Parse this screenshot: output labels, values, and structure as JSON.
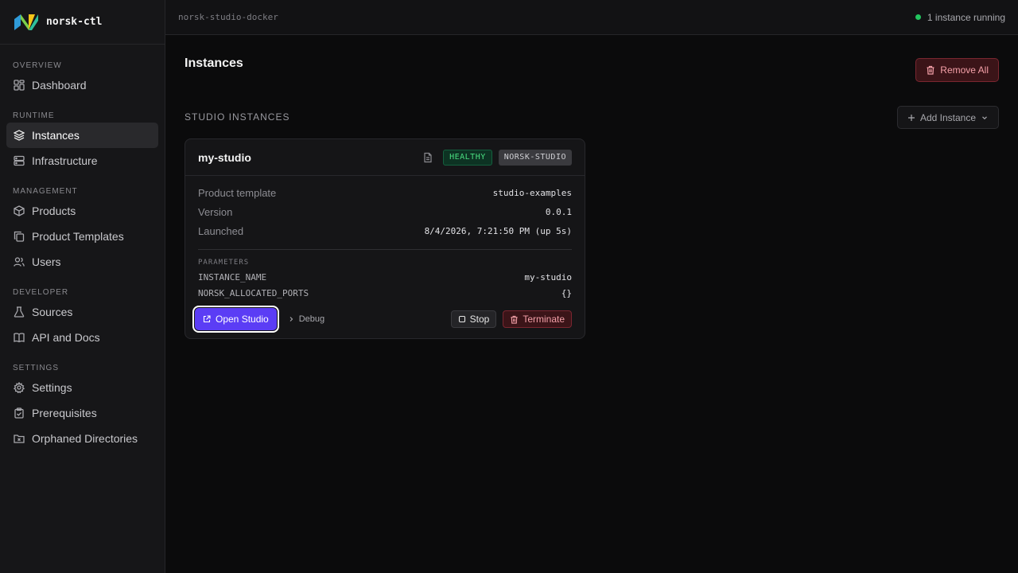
{
  "brand": {
    "name": "norsk-ctl",
    "logo_icon": "norsk-logo-icon"
  },
  "sidebar": {
    "sections": [
      {
        "label": "OVERVIEW",
        "items": [
          {
            "label": "Dashboard",
            "icon": "grid-icon"
          }
        ]
      },
      {
        "label": "RUNTIME",
        "items": [
          {
            "label": "Instances",
            "icon": "layers-icon",
            "active": true
          },
          {
            "label": "Infrastructure",
            "icon": "server-icon"
          }
        ]
      },
      {
        "label": "MANAGEMENT",
        "items": [
          {
            "label": "Products",
            "icon": "box-icon"
          },
          {
            "label": "Product Templates",
            "icon": "copy-icon"
          },
          {
            "label": "Users",
            "icon": "users-icon"
          }
        ]
      },
      {
        "label": "DEVELOPER",
        "items": [
          {
            "label": "Sources",
            "icon": "flask-icon"
          },
          {
            "label": "API and Docs",
            "icon": "book-icon"
          }
        ]
      },
      {
        "label": "SETTINGS",
        "items": [
          {
            "label": "Settings",
            "icon": "gear-icon"
          },
          {
            "label": "Prerequisites",
            "icon": "clipboard-check-icon"
          },
          {
            "label": "Orphaned Directories",
            "icon": "folder-x-icon"
          }
        ]
      }
    ]
  },
  "topbar": {
    "context": "norsk-studio-docker",
    "status": "1 instance running",
    "status_color": "#22c55e"
  },
  "main": {
    "title": "Instances",
    "remove_all_label": "Remove All",
    "section_title": "STUDIO INSTANCES",
    "add_instance_label": "Add Instance"
  },
  "instance": {
    "name": "my-studio",
    "health_badge": "HEALTHY",
    "kind_badge": "NORSK-STUDIO",
    "details": {
      "template_label": "Product template",
      "template_value": "studio-examples",
      "version_label": "Version",
      "version_value": "0.0.1",
      "launched_label": "Launched",
      "launched_value": "8/4/2026, 7:21:50 PM (up 5s)"
    },
    "params_label": "PARAMETERS",
    "params": {
      "p1_key": "INSTANCE_NAME",
      "p1_value": "my-studio",
      "p2_key": "NORSK_ALLOCATED_PORTS",
      "p2_value": "{}"
    },
    "actions": {
      "open": "Open Studio",
      "debug": "Debug",
      "stop": "Stop",
      "terminate": "Terminate"
    }
  },
  "colors": {
    "accent": "#5b3df5",
    "danger": "#f4a0a8",
    "healthy": "#4ade80"
  }
}
